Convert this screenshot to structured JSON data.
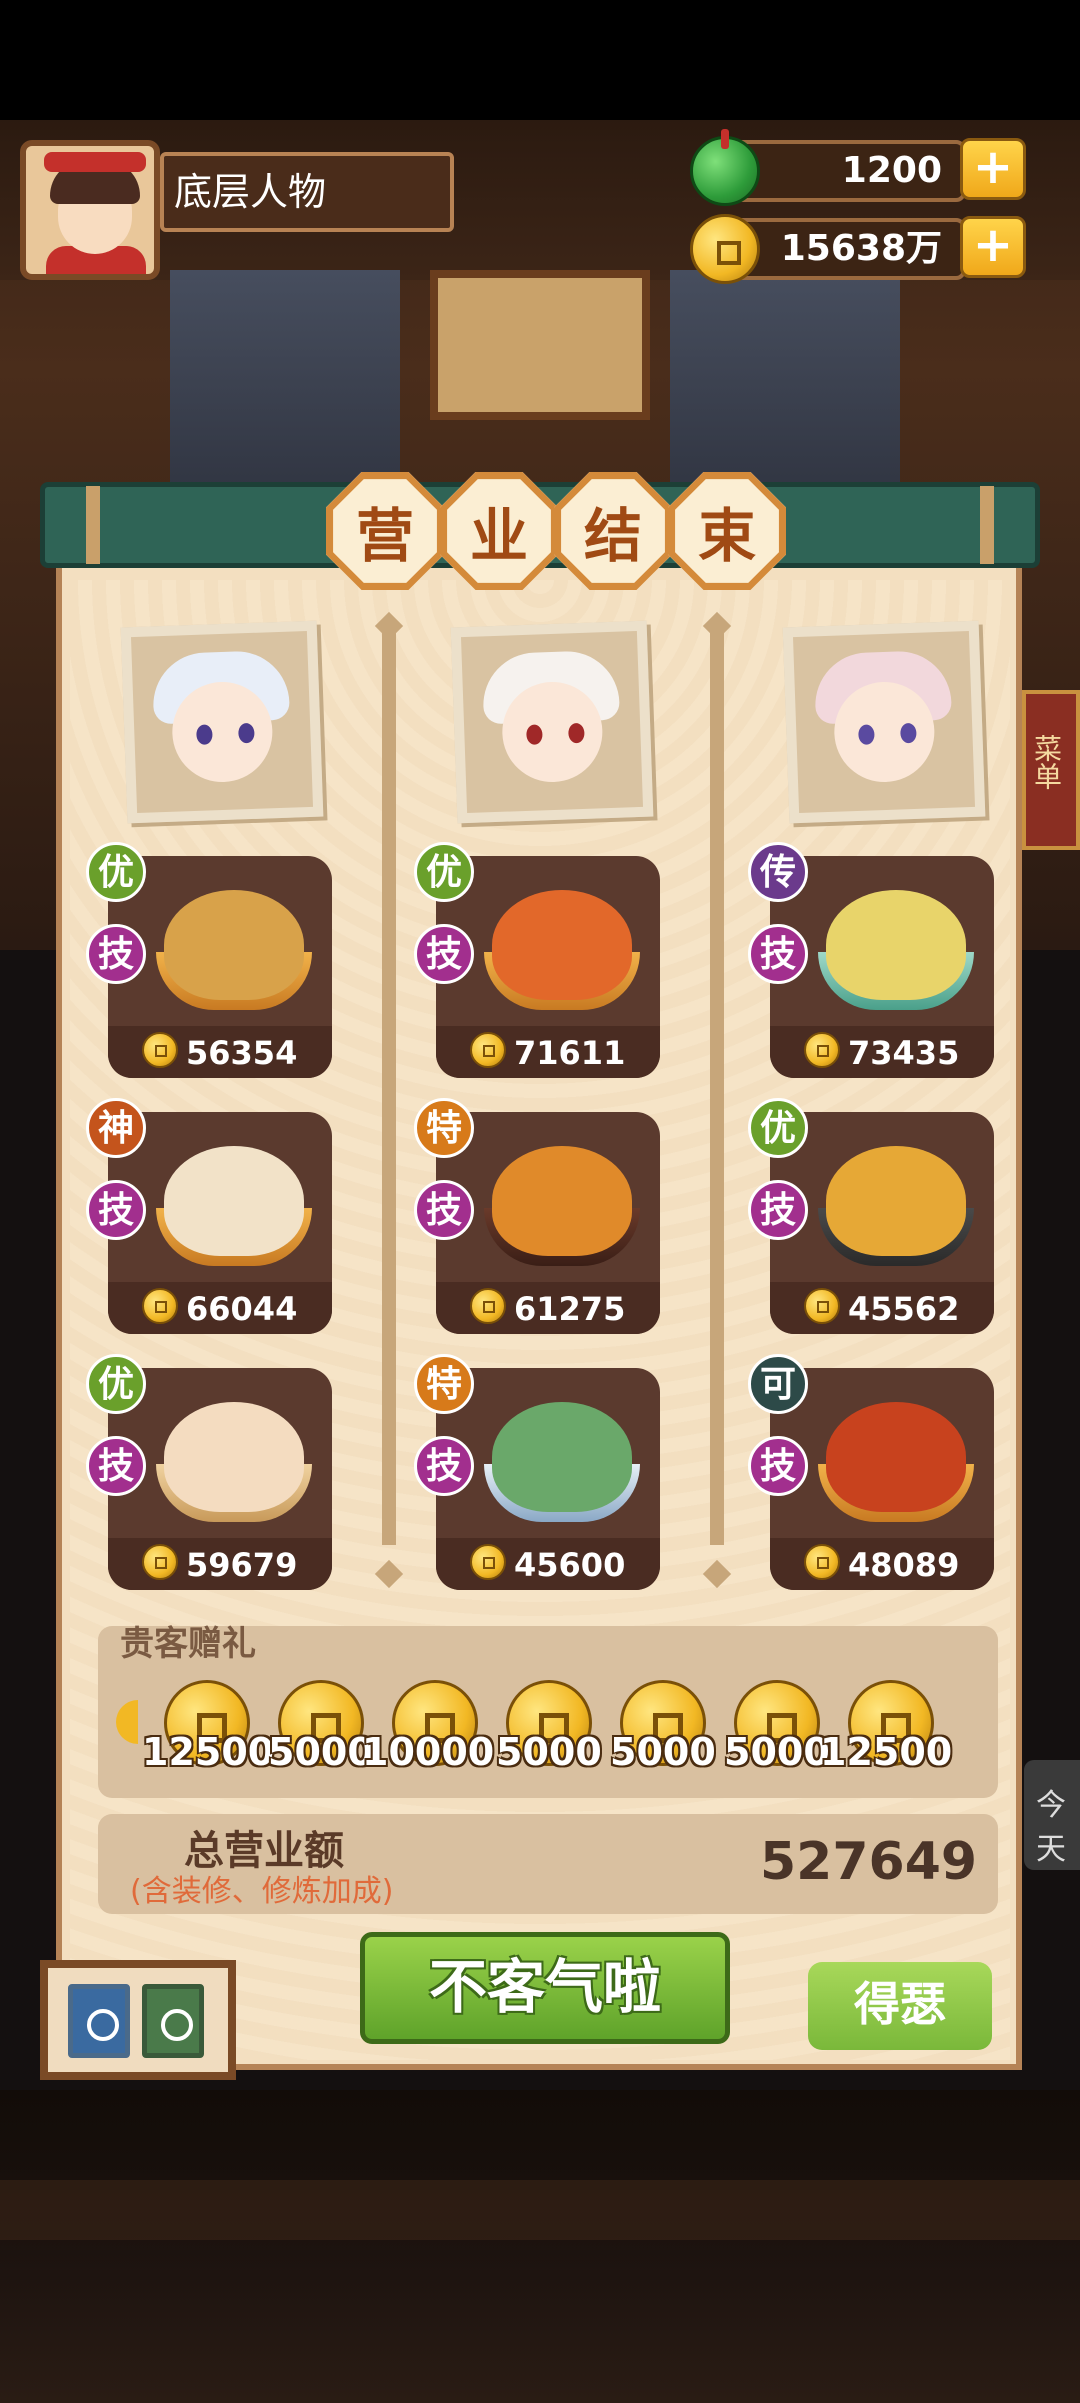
{
  "player": {
    "name": "底层人物"
  },
  "currency": {
    "jade": "1200",
    "coins": "15638万"
  },
  "panel": {
    "title_chars": [
      "营",
      "业",
      "结",
      "束"
    ]
  },
  "dishes": [
    {
      "grade": "优",
      "skill": "技",
      "price": "56354"
    },
    {
      "grade": "优",
      "skill": "技",
      "price": "71611"
    },
    {
      "grade": "传",
      "skill": "技",
      "price": "73435"
    },
    {
      "grade": "神",
      "skill": "技",
      "price": "66044"
    },
    {
      "grade": "特",
      "skill": "技",
      "price": "61275"
    },
    {
      "grade": "优",
      "skill": "技",
      "price": "45562"
    },
    {
      "grade": "优",
      "skill": "技",
      "price": "59679"
    },
    {
      "grade": "特",
      "skill": "技",
      "price": "45600"
    },
    {
      "grade": "可",
      "skill": "技",
      "price": "48089"
    }
  ],
  "gifts": {
    "title": "贵客赠礼",
    "values": [
      "12500",
      "5000",
      "10000",
      "5000",
      "5000",
      "5000",
      "12500"
    ]
  },
  "total": {
    "label": "总营业额",
    "note": "(含装修、修炼加成)",
    "value": "527649"
  },
  "buttons": {
    "main": "不客气啦",
    "side": "得瑟"
  },
  "side": {
    "today": "今天",
    "menu": "菜单"
  },
  "colors": {
    "banner": "#2f6456",
    "panel": "#f3dfc0",
    "button_green": "#7ab83a",
    "title_tile": "#d48a3a"
  }
}
